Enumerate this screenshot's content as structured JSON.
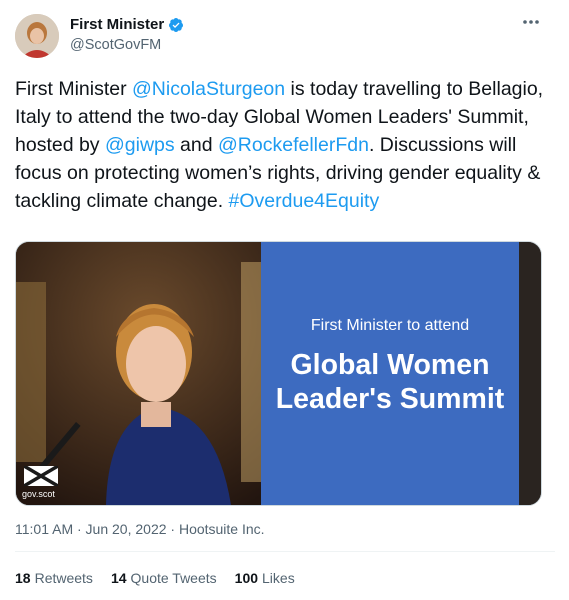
{
  "author": {
    "display_name": "First Minister",
    "handle": "@ScotGovFM",
    "verified": true
  },
  "tweet": {
    "segments": [
      {
        "text": "First Minister ",
        "link": false
      },
      {
        "text": "@NicolaSturgeon",
        "link": true
      },
      {
        "text": " is today travelling to Bellagio, Italy to attend the two-day Global Women Leaders' Summit, hosted by ",
        "link": false
      },
      {
        "text": "@giwps",
        "link": true
      },
      {
        "text": " and ",
        "link": false
      },
      {
        "text": "@RockefellerFdn",
        "link": true
      },
      {
        "text": ". Discussions will focus on protecting women’s rights, driving gender equality & tackling climate change. ",
        "link": false
      },
      {
        "text": "#Overdue4Equity",
        "link": true
      }
    ]
  },
  "media": {
    "subtitle": "First Minister to attend",
    "title": "Global Women Leader's Summit",
    "logo_label": "gov.scot"
  },
  "meta": {
    "timestamp": "11:01 AM · Jun 20, 2022 · Hootsuite Inc."
  },
  "stats": {
    "retweets_count": "18",
    "retweets_label": "Retweets",
    "quotes_count": "14",
    "quotes_label": "Quote Tweets",
    "likes_count": "100",
    "likes_label": "Likes"
  },
  "colors": {
    "link": "#1d9bf0",
    "panel_blue": "#3d6bc0",
    "verified": "#1d9bf0"
  }
}
